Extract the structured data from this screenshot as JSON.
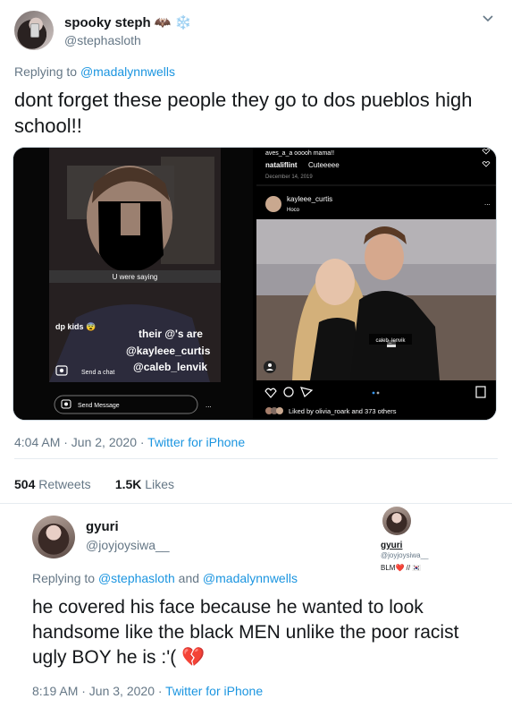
{
  "tweet": {
    "author_name": "spooky steph 🦇 ❄️",
    "author_handle": "@stephasloth",
    "replying_prefix": "Replying to ",
    "replying_handle": "@madalynnwells",
    "text": "dont forget these people they go to dos pueblos high school!!",
    "timestamp": "4:04 AM · Jun 2, 2020 · ",
    "source": "Twitter for iPhone",
    "retweets_count": "504",
    "retweets_label": " Retweets",
    "likes_count": "1.5K",
    "likes_label": " Likes"
  },
  "media": {
    "left": {
      "caption1": "U were saying",
      "caption2": "dp kids 😨",
      "caption3_line1": "their @'s are",
      "caption3_line2": "@kayleee_curtis",
      "caption3_line3": "@caleb_lenvik",
      "send_chat": "Send a chat",
      "send_message": "Send Message",
      "more": "..."
    },
    "right": {
      "comment1": "aves_a_a ooooh mama!!",
      "comment2_user": "nataliflint",
      "comment2_text": " Cuteeeee",
      "date": "December 14, 2019",
      "post_user": "kayleee_curtis",
      "post_sub": "Hoco",
      "tag": "caleb_lenvik",
      "likes_text": "Liked by olivia_roark and 373 others",
      "more": "..."
    }
  },
  "reply": {
    "author_name": "gyuri",
    "author_handle": "@joyjoysiwa__",
    "replying_prefix": "Replying to ",
    "replying_handle1": "@stephasloth",
    "replying_and": " and ",
    "replying_handle2": "@madalynnwells",
    "text": "he covered his face because he wanted to look handsome like the black MEN unlike the poor racist ugly BOY he is :'( 💔",
    "timestamp": "8:19 AM · Jun 3, 2020 · ",
    "source": "Twitter for iPhone",
    "card_name": "gyuri",
    "card_handle": "@joyjoysiwa__",
    "card_bio": "BLM❤️ // 🇰🇷"
  },
  "colors": {
    "link": "#1b95e0",
    "muted": "#657786",
    "text": "#14171a"
  }
}
